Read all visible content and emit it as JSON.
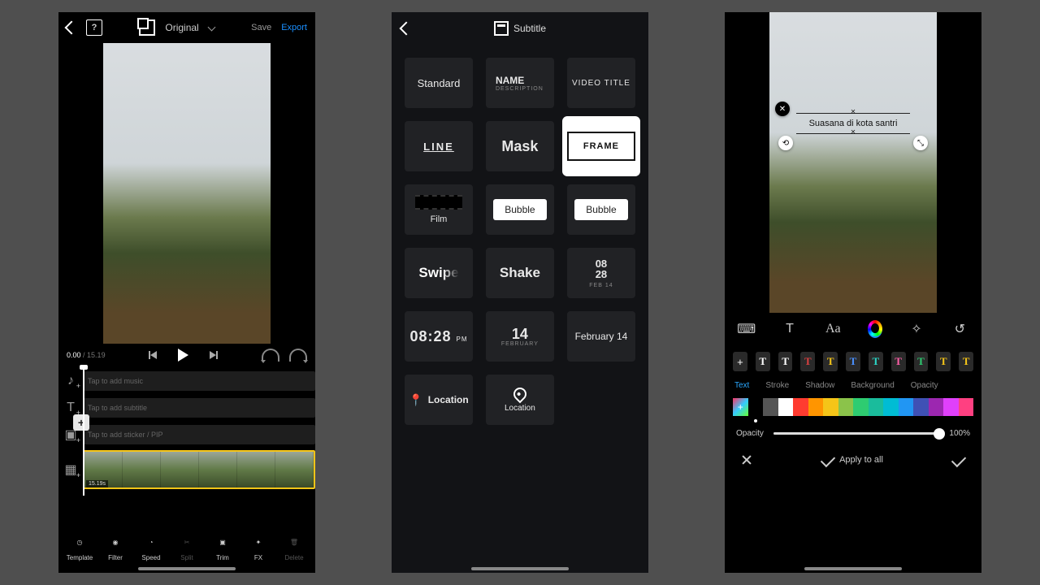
{
  "phone1": {
    "header": {
      "title": "Original",
      "save": "Save",
      "export": "Export",
      "help_glyph": "?"
    },
    "time": {
      "current": "0.00",
      "total": "15.19"
    },
    "tracks": {
      "music": "Tap to add music",
      "subtitle": "Tap to add subtitle",
      "sticker": "Tap to add sticker / PIP",
      "clip_duration": "15.19s"
    },
    "toolbar": [
      "Template",
      "Filter",
      "Speed",
      "Split",
      "Trim",
      "FX",
      "Delete"
    ]
  },
  "phone2": {
    "title": "Subtitle",
    "items": {
      "standard": "Standard",
      "name": "NAME",
      "name_sub": "DESCRIPTION",
      "video_title": "VIDEO TITLE",
      "line": "LINE",
      "mask": "Mask",
      "frame": "FRAME",
      "film": "Film",
      "bubble1": "Bubble",
      "bubble2": "Bubble",
      "swipe": "Swipe",
      "shake": "Shake",
      "date_stack_a": "08",
      "date_stack_b": "28",
      "date_stack_sub": "FEB 14",
      "time": "08:28",
      "time_pm": "PM",
      "date_num": "14",
      "date_month": "FEBRUARY",
      "date_long": "February 14",
      "location1": "Location",
      "location2": "Location"
    }
  },
  "phone3": {
    "text_overlay": "Suasana di kota santri",
    "icon_tabs": [
      "keyboard",
      "text-box",
      "font",
      "color",
      "transform",
      "history"
    ],
    "style_chips": [
      "+",
      "T",
      "T",
      "T",
      "T",
      "T",
      "T",
      "T",
      "T",
      "T",
      "T"
    ],
    "style_chip_colors": [
      "#fff",
      "#fff",
      "#fff",
      "#d94040",
      "#f5c518",
      "#4a90ff",
      "#2bd8c8",
      "#ff5fa8",
      "#2ecc71",
      "#f5c518",
      "#f5c518"
    ],
    "tabs": [
      "Text",
      "Stroke",
      "Shadow",
      "Background",
      "Opacity"
    ],
    "active_tab_index": 0,
    "palette": [
      "add",
      "#000000",
      "#555555",
      "#ffffff",
      "#ff3b30",
      "#ff9500",
      "#f5c518",
      "#8bc34a",
      "#2ecc71",
      "#1abc9c",
      "#00bcd4",
      "#2196f3",
      "#3f51b5",
      "#9c27b0",
      "#e040fb",
      "#ff4081"
    ],
    "selected_color_index": 1,
    "opacity_label": "Opacity",
    "opacity_value": "100%",
    "opacity_pct": 100,
    "apply_all": "Apply to all"
  }
}
